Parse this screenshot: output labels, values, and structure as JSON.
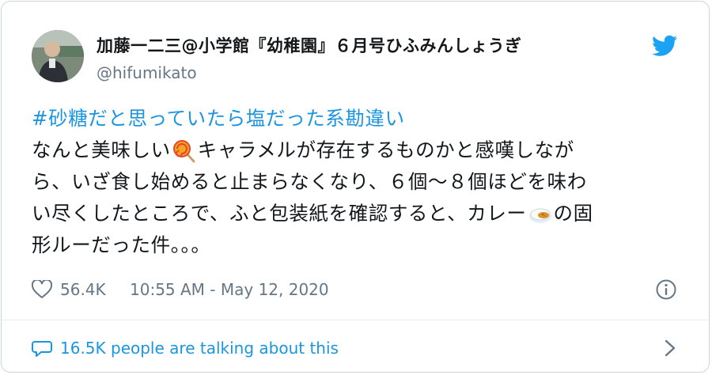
{
  "user": {
    "display_name": "加藤一二三@小学館『幼稚園』６月号ひふみんしょうぎ",
    "handle": "@hifumikato"
  },
  "tweet": {
    "hashtag": "#砂糖だと思っていたら塩だった系勘違い",
    "line1_before_emoji": "なんと美味しい",
    "line1_after_emoji": "キャラメルが存在するものかと感嘆しなが",
    "line2": "ら、いざ食し始めると止まらなくなり、６個〜８個ほどを味わ",
    "line3_before_emoji": "い尽くしたところで、ふと包装紙を確認すると、カレー",
    "line3_after_emoji": "の固",
    "line4": "形ルーだった件。。。"
  },
  "meta": {
    "likes": "56.4K",
    "timestamp": "10:55 AM - May 12, 2020"
  },
  "footer": {
    "talking_text": "16.5K people are talking about this"
  },
  "colors": {
    "link": "#1b95e0",
    "secondary": "#657786",
    "text": "#14171a",
    "border": "#ccd6dd"
  },
  "icons": {
    "bird": "twitter-bird-icon",
    "heart": "heart-icon",
    "info": "info-icon",
    "comment": "comment-icon",
    "chevron": "chevron-right-icon",
    "candy": "lollipop-emoji",
    "curry": "curry-emoji"
  }
}
